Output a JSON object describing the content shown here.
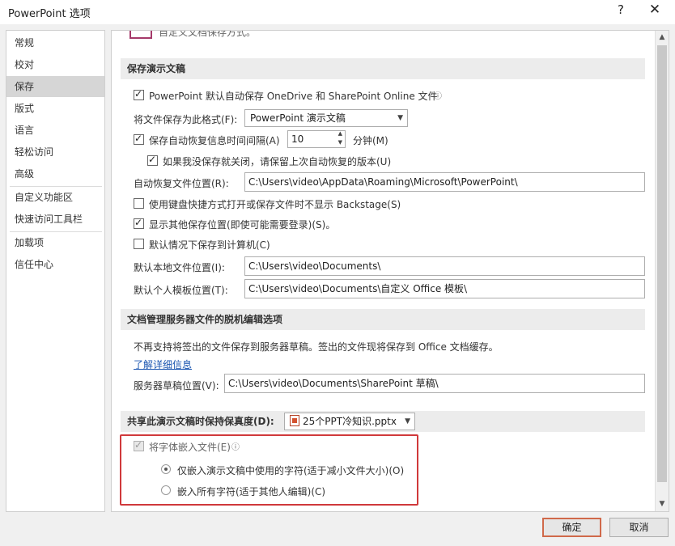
{
  "window": {
    "title": "PowerPoint 选项",
    "help": "?",
    "close": "✕"
  },
  "sidebar": {
    "items": [
      {
        "label": "常规"
      },
      {
        "label": "校对"
      },
      {
        "label": "保存"
      },
      {
        "label": "版式"
      },
      {
        "label": "语言"
      },
      {
        "label": "轻松访问"
      },
      {
        "label": "高级"
      },
      {
        "label": "自定义功能区"
      },
      {
        "label": "快速访问工具栏"
      },
      {
        "label": "加载项"
      },
      {
        "label": "信任中心"
      }
    ],
    "active": "保存"
  },
  "top_partial": {
    "text": "自定义文档保存方式。"
  },
  "save": {
    "heading": "保存演示文稿",
    "autosave_label": "PowerPoint 默认自动保存 OneDrive 和 SharePoint Online 文件",
    "format_label": "将文件保存为此格式(F):",
    "format_value": "PowerPoint 演示文稿",
    "autorecover_label": "保存自动恢复信息时间间隔(A)",
    "autorecover_value": "10",
    "minutes_label": "分钟(M)",
    "keep_last_label": "如果我没保存就关闭，请保留上次自动恢复的版本(U)",
    "autorecover_loc_label": "自动恢复文件位置(R):",
    "autorecover_loc_value": "C:\\Users\\video\\AppData\\Roaming\\Microsoft\\PowerPoint\\",
    "no_backstage_label": "使用键盘快捷方式打开或保存文件时不显示 Backstage(S)",
    "show_locations_label": "显示其他保存位置(即使可能需要登录)(S)。",
    "default_computer_label": "默认情况下保存到计算机(C)",
    "local_loc_label": "默认本地文件位置(I):",
    "local_loc_value": "C:\\Users\\video\\Documents\\",
    "template_loc_label": "默认个人模板位置(T):",
    "template_loc_value": "C:\\Users\\video\\Documents\\自定义 Office 模板\\"
  },
  "offline": {
    "heading": "文档管理服务器文件的脱机编辑选项",
    "desc": "不再支持将签出的文件保存到服务器草稿。签出的文件现将保存到 Office 文档缓存。",
    "learn_more": "了解详细信息",
    "drafts_label": "服务器草稿位置(V):",
    "drafts_value": "C:\\Users\\video\\Documents\\SharePoint 草稿\\"
  },
  "fidelity": {
    "heading": "共享此演示文稿时保持保真度(D):",
    "file_value": "25个PPT冷知识.pptx",
    "embed_label": "将字体嵌入文件(E)",
    "embed_used_label": "仅嵌入演示文稿中使用的字符(适于减小文件大小)(O)",
    "embed_all_label": "嵌入所有字符(适于其他人编辑)(C)"
  },
  "buttons": {
    "ok": "确定",
    "cancel": "取消"
  },
  "colors": {
    "highlight": "#d0393b",
    "link": "#1a55b0"
  }
}
